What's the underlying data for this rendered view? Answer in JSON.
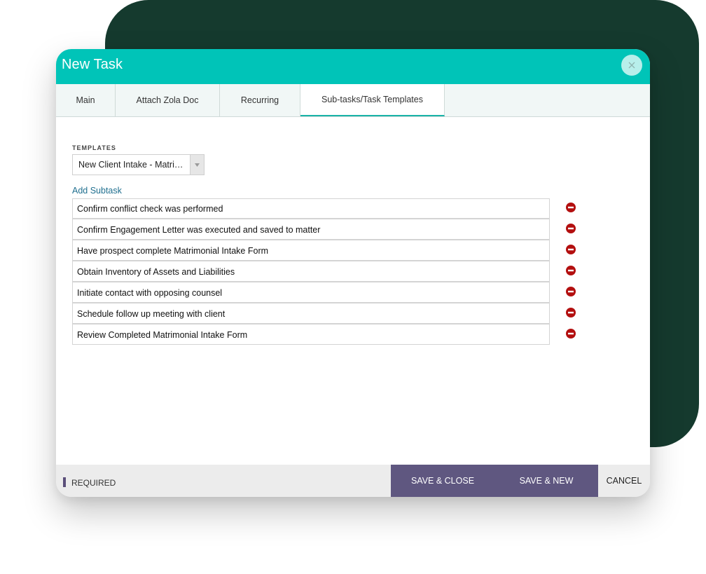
{
  "dialog": {
    "title": "New Task",
    "close_icon": "close-icon"
  },
  "tabs": [
    {
      "label": "Main",
      "active": false
    },
    {
      "label": "Attach Zola Doc",
      "active": false
    },
    {
      "label": "Recurring",
      "active": false
    },
    {
      "label": "Sub-tasks/Task Templates",
      "active": true
    }
  ],
  "templates": {
    "label": "TEMPLATES",
    "selected": "New Client Intake - Matrimonial",
    "arrow_icon": "triangle-down-icon"
  },
  "add_subtask_label": "Add Subtask",
  "subtasks": [
    "Confirm conflict check was performed",
    "Confirm Engagement Letter was executed and saved to matter",
    "Have prospect complete Matrimonial Intake Form",
    "Obtain Inventory of Assets and Liabilities",
    "Initiate contact with opposing counsel",
    "Schedule follow up meeting with client",
    "Review Completed Matrimonial Intake Form"
  ],
  "remove_icon": "remove-circle-icon",
  "footer": {
    "required_label": "REQUIRED",
    "save_close_label": "SAVE & CLOSE",
    "save_new_label": "SAVE & NEW",
    "cancel_label": "CANCEL"
  },
  "colors": {
    "header": "#00c4b8",
    "background_shape": "#153a2e",
    "primary_button": "#5f5780",
    "link": "#1f6f8f",
    "remove_icon": "#b30f0f"
  }
}
